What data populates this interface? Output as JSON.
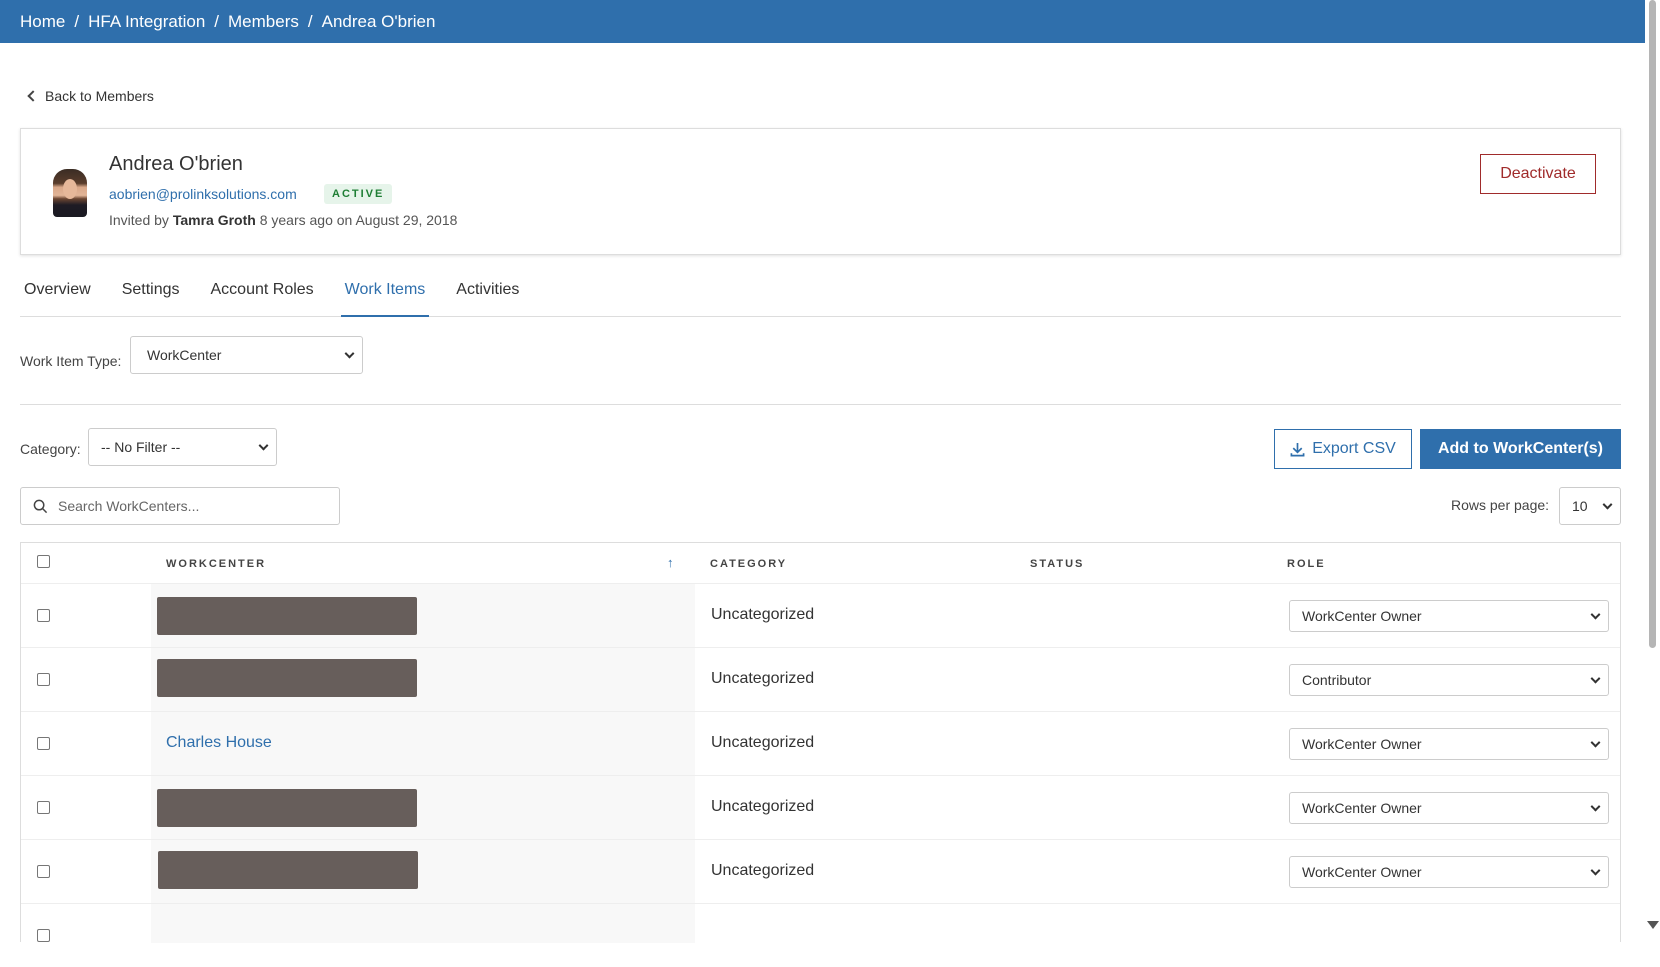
{
  "breadcrumb": [
    "Home",
    "HFA Integration",
    "Members",
    "Andrea O'brien"
  ],
  "breadcrumb_separator": "/",
  "back_link": "Back to Members",
  "member": {
    "name": "Andrea O'brien",
    "email": "aobrien@prolinksolutions.com",
    "status": "ACTIVE",
    "invited_prefix": "Invited by",
    "invited_by": "Tamra Groth",
    "invited_suffix": "8 years ago on August 29, 2018",
    "deactivate_label": "Deactivate"
  },
  "tabs": [
    {
      "label": "Overview",
      "active": false
    },
    {
      "label": "Settings",
      "active": false
    },
    {
      "label": "Account Roles",
      "active": false
    },
    {
      "label": "Work Items",
      "active": true
    },
    {
      "label": "Activities",
      "active": false
    }
  ],
  "work_item_type": {
    "label": "Work Item Type:",
    "value": "WorkCenter"
  },
  "category_filter": {
    "label": "Category:",
    "value": "-- No Filter --"
  },
  "export_label": "Export CSV",
  "add_label": "Add to WorkCenter(s)",
  "search": {
    "placeholder": "Search WorkCenters..."
  },
  "rows_per_page": {
    "label": "Rows per page:",
    "value": "10"
  },
  "table": {
    "headers": {
      "workcenter": "WORKCENTER",
      "category": "CATEGORY",
      "status": "STATUS",
      "role": "ROLE"
    },
    "rows": [
      {
        "workcenter": "",
        "redacted": true,
        "category": "Uncategorized",
        "role": "WorkCenter Owner"
      },
      {
        "workcenter": "",
        "redacted": true,
        "category": "Uncategorized",
        "role": "Contributor"
      },
      {
        "workcenter": "Charles House",
        "redacted": false,
        "category": "Uncategorized",
        "role": "WorkCenter Owner"
      },
      {
        "workcenter": "",
        "redacted": true,
        "category": "Uncategorized",
        "role": "WorkCenter Owner"
      },
      {
        "workcenter": "",
        "redacted": true,
        "category": "Uncategorized",
        "role": "WorkCenter Owner"
      }
    ]
  },
  "colors": {
    "primary": "#2f6fac",
    "danger": "#a02b2b",
    "active_badge_bg": "#e6f4ea",
    "active_badge_text": "#1e7e34",
    "redaction": "#675e5b"
  }
}
